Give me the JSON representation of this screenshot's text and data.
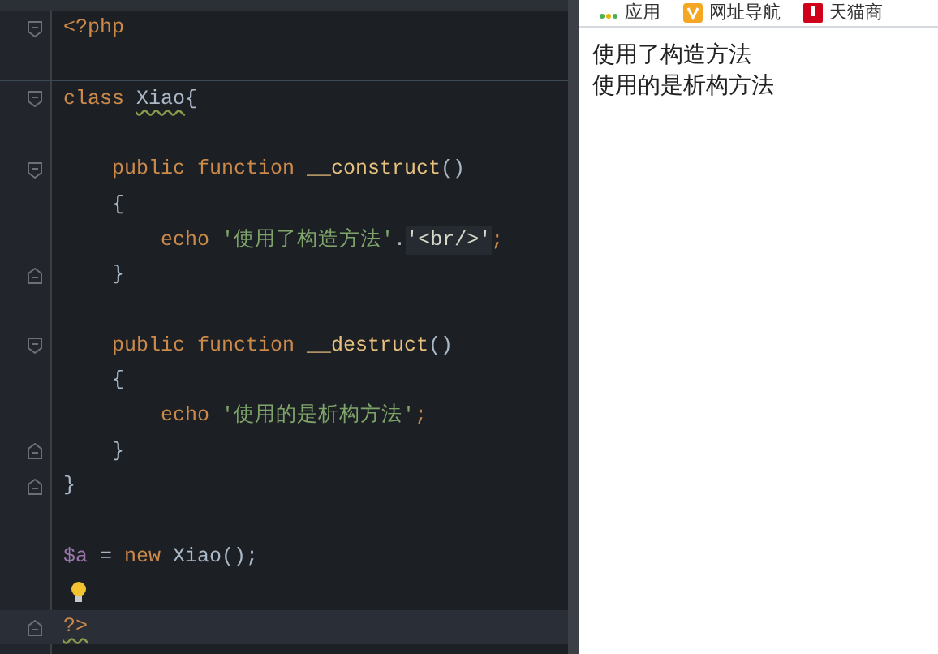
{
  "editor": {
    "lines": [
      {
        "kind": "fold-start",
        "current": false,
        "hint": false,
        "separator": false,
        "tokens": [
          {
            "kind": "tag",
            "text": "<?php",
            "squiggle": false
          }
        ]
      },
      {
        "current": false,
        "hint": false,
        "separator": true
      },
      {
        "kind": "fold-start",
        "current": false,
        "hint": false,
        "separator": false,
        "tokens": [
          {
            "kind": "keyword",
            "text": "class ",
            "squiggle": false
          },
          {
            "kind": "plain",
            "text": "Xiao",
            "squiggle": true
          },
          {
            "kind": "plain",
            "text": "{",
            "squiggle": false
          }
        ]
      },
      {
        "current": false,
        "hint": false,
        "separator": false
      },
      {
        "kind": "fold-start",
        "current": false,
        "hint": false,
        "separator": false,
        "tokens": [
          {
            "kind": "keyword",
            "text": "    public function ",
            "squiggle": false
          },
          {
            "kind": "function",
            "text": "__construct",
            "squiggle": false
          },
          {
            "kind": "plain",
            "text": "()",
            "squiggle": false
          }
        ]
      },
      {
        "current": false,
        "hint": false,
        "separator": false,
        "tokens": [
          {
            "kind": "plain",
            "text": "    {",
            "squiggle": false
          }
        ]
      },
      {
        "current": false,
        "hint": false,
        "separator": false,
        "tokens": [
          {
            "kind": "keyword",
            "text": "        echo ",
            "squiggle": false
          },
          {
            "kind": "string",
            "text": "'使用了构造方法'",
            "squiggle": false
          },
          {
            "kind": "plain",
            "text": ".",
            "squiggle": false
          },
          {
            "kind": "string-html",
            "text": "'<br/>'",
            "squiggle": false
          },
          {
            "kind": "keyword",
            "text": ";",
            "squiggle": false
          }
        ]
      },
      {
        "kind": "fold-end",
        "current": false,
        "hint": false,
        "separator": false,
        "tokens": [
          {
            "kind": "plain",
            "text": "    }",
            "squiggle": false
          }
        ]
      },
      {
        "current": false,
        "hint": false,
        "separator": false
      },
      {
        "kind": "fold-start",
        "current": false,
        "hint": false,
        "separator": false,
        "tokens": [
          {
            "kind": "keyword",
            "text": "    public function ",
            "squiggle": false
          },
          {
            "kind": "function",
            "text": "__destruct",
            "squiggle": false
          },
          {
            "kind": "plain",
            "text": "()",
            "squiggle": false
          }
        ]
      },
      {
        "current": false,
        "hint": false,
        "separator": false,
        "tokens": [
          {
            "kind": "plain",
            "text": "    {",
            "squiggle": false
          }
        ]
      },
      {
        "current": false,
        "hint": false,
        "separator": false,
        "tokens": [
          {
            "kind": "keyword",
            "text": "        echo ",
            "squiggle": false
          },
          {
            "kind": "string",
            "text": "'使用的是析构方法'",
            "squiggle": false
          },
          {
            "kind": "keyword",
            "text": ";",
            "squiggle": false
          }
        ]
      },
      {
        "kind": "fold-end",
        "current": false,
        "hint": false,
        "separator": false,
        "tokens": [
          {
            "kind": "plain",
            "text": "    }",
            "squiggle": false
          }
        ]
      },
      {
        "kind": "fold-end",
        "current": false,
        "hint": false,
        "separator": false,
        "tokens": [
          {
            "kind": "plain",
            "text": "}",
            "squiggle": false
          }
        ]
      },
      {
        "current": false,
        "hint": false,
        "separator": false
      },
      {
        "current": false,
        "hint": false,
        "separator": false,
        "tokens": [
          {
            "kind": "variable",
            "text": "$a",
            "squiggle": false
          },
          {
            "kind": "plain",
            "text": " = ",
            "squiggle": false
          },
          {
            "kind": "keyword",
            "text": "new ",
            "squiggle": false
          },
          {
            "kind": "plain",
            "text": "Xiao();",
            "squiggle": false
          }
        ]
      },
      {
        "current": false,
        "hint": true,
        "separator": false
      },
      {
        "kind": "fold-end",
        "current": true,
        "hint": false,
        "separator": false,
        "tokens": [
          {
            "kind": "tag",
            "text": "?>",
            "squiggle": true
          }
        ]
      }
    ]
  },
  "browser": {
    "bookmarks": [
      {
        "kind": "apps",
        "label": "应用"
      },
      {
        "kind": "nav",
        "label": "网址导航"
      },
      {
        "kind": "mall",
        "label": "天猫商"
      }
    ],
    "output": [
      "使用了构造方法",
      "使用的是析构方法"
    ]
  }
}
